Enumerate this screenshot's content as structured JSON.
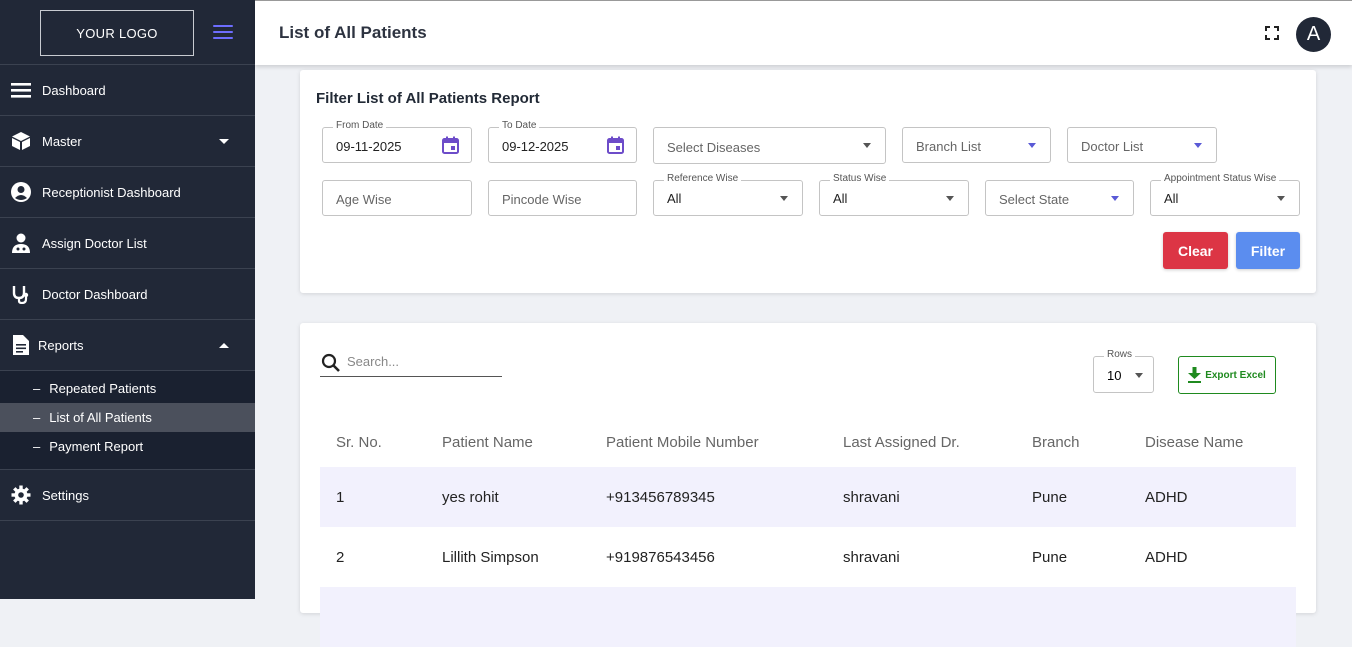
{
  "sidebar": {
    "logo": "YOUR LOGO",
    "items": [
      {
        "label": "Dashboard",
        "icon": "menu-lines-icon"
      },
      {
        "label": "Master",
        "icon": "cube-icon"
      },
      {
        "label": "Receptionist Dashboard",
        "icon": "user-circle-icon"
      },
      {
        "label": "Assign Doctor List",
        "icon": "doctor-icon"
      },
      {
        "label": "Doctor Dashboard",
        "icon": "stethoscope-icon"
      },
      {
        "label": "Reports",
        "icon": "document-icon"
      },
      {
        "label": "Settings",
        "icon": "gear-icon"
      }
    ],
    "reports_sub": [
      "Repeated Patients",
      "List of All Patients",
      "Payment Report"
    ],
    "active_sub": "List of All Patients"
  },
  "header": {
    "title": "List of All Patients",
    "avatar_letter": "A"
  },
  "filter": {
    "title": "Filter List of All Patients Report",
    "from_date": {
      "label": "From Date",
      "value": "09-11-2025"
    },
    "to_date": {
      "label": "To Date",
      "value": "09-12-2025"
    },
    "diseases_placeholder": "Select Diseases",
    "branch_placeholder": "Branch List",
    "doctor_placeholder": "Doctor List",
    "age_placeholder": "Age Wise",
    "pincode_placeholder": "Pincode Wise",
    "reference": {
      "label": "Reference Wise",
      "value": "All"
    },
    "status": {
      "label": "Status Wise",
      "value": "All"
    },
    "state_placeholder": "Select State",
    "appointment_status": {
      "label": "Appointment Status Wise",
      "value": "All"
    },
    "clear_label": "Clear",
    "filter_label": "Filter"
  },
  "table_controls": {
    "search_placeholder": "Search...",
    "rows_label": "Rows",
    "rows_value": "10",
    "export_label": "Export Excel"
  },
  "table": {
    "headers": [
      "Sr. No.",
      "Patient Name",
      "Patient Mobile Number",
      "Last Assigned Dr.",
      "Branch",
      "Disease Name"
    ],
    "rows": [
      [
        "1",
        "yes rohit",
        "+913456789345",
        "shravani",
        "Pune",
        "ADHD"
      ],
      [
        "2",
        "Lillith Simpson",
        "+919876543456",
        "shravani",
        "Pune",
        "ADHD"
      ]
    ]
  },
  "colors": {
    "sidebar_bg": "#212837",
    "accent": "#6d6dff",
    "clear_btn": "#dc3545",
    "filter_btn": "#5b8def",
    "export_green": "#1f8a1f",
    "row_highlight": "#f2f1fd"
  }
}
